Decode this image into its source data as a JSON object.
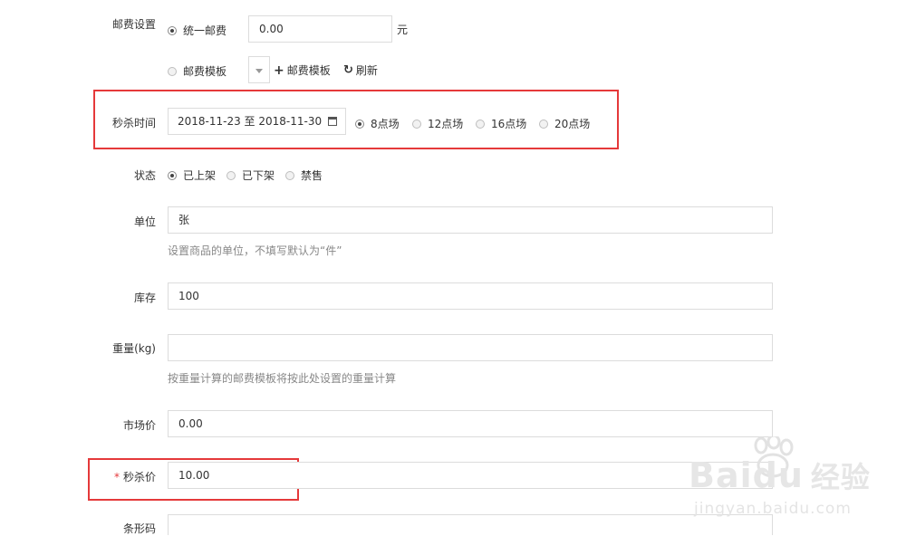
{
  "shipping": {
    "label": "邮费设置",
    "unified_option": "统一邮费",
    "unified_value": "0.00",
    "unit": "元",
    "template_option": "邮费模板",
    "add_template": "邮费模板",
    "refresh": "刷新"
  },
  "seckill_time": {
    "label": "秒杀时间",
    "date_range": "2018-11-23 至 2018-11-30",
    "sessions": [
      "8点场",
      "12点场",
      "16点场",
      "20点场"
    ],
    "selected": "8点场"
  },
  "status": {
    "label": "状态",
    "options": [
      "已上架",
      "已下架",
      "禁售"
    ],
    "selected": "已上架"
  },
  "unit": {
    "label": "单位",
    "value": "张",
    "help": "设置商品的单位，不填写默认为“件”"
  },
  "stock": {
    "label": "库存",
    "value": "100"
  },
  "weight": {
    "label": "重量(kg)",
    "value": "",
    "help": "按重量计算的邮费模板将按此处设置的重量计算"
  },
  "market_price": {
    "label": "市场价",
    "value": "0.00"
  },
  "seckill_price": {
    "label": "秒杀价",
    "required_mark": "*",
    "value": "10.00"
  },
  "barcode": {
    "label": "条形码",
    "value": ""
  },
  "watermark": {
    "brand": "Bai",
    "brand2": "du",
    "suffix": "经验",
    "url": "jingyan.baidu.com"
  },
  "colors": {
    "highlight": "#e5393a",
    "required": "#e4393c",
    "border": "#dcdcdc"
  }
}
